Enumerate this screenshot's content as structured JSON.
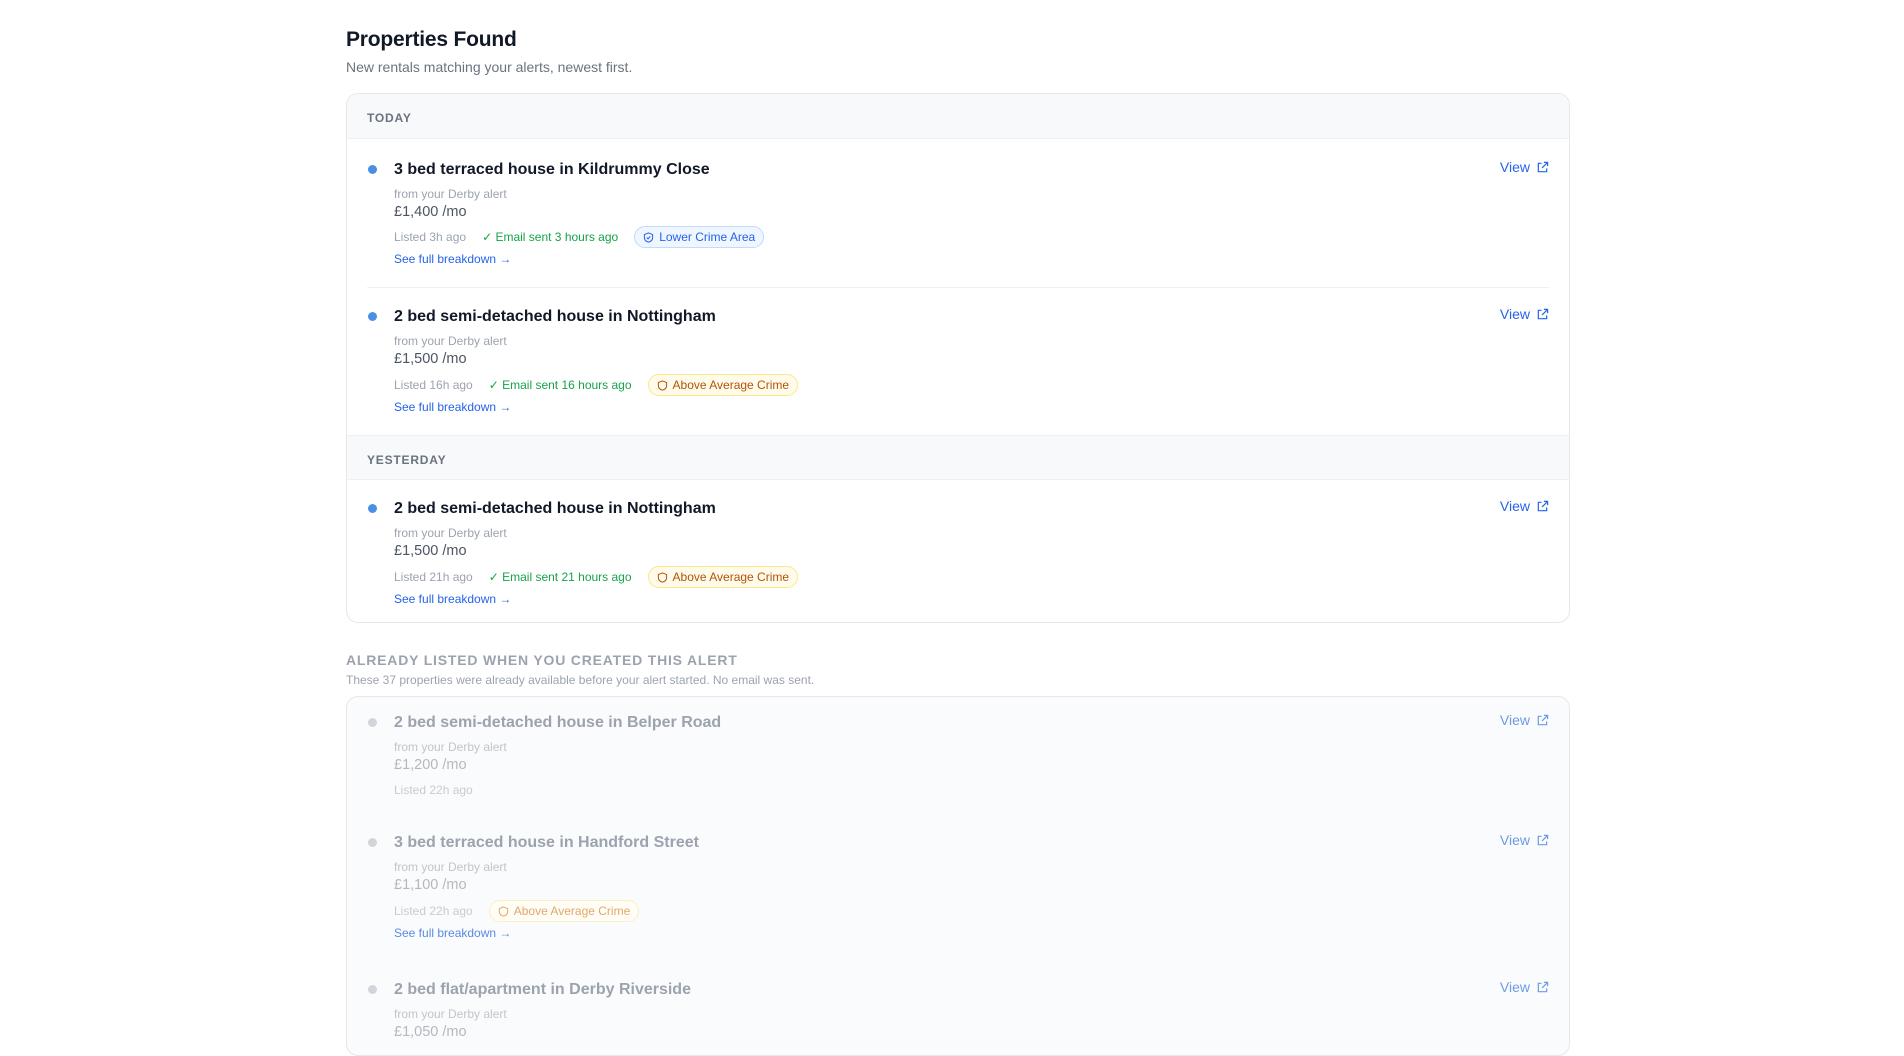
{
  "header": {
    "title": "Properties Found",
    "subtitle": "New rentals matching your alerts, newest first."
  },
  "groups": [
    {
      "label": "TODAY",
      "items": [
        {
          "title": "3 bed terraced house in Kildrummy Close",
          "source": "from your Derby alert",
          "price": "£1,400 /mo",
          "listed": "Listed 3h ago",
          "email": "✓ Email sent 3 hours ago",
          "crime": "Lower Crime Area",
          "crime_level": "low",
          "breakdown": "See full breakdown →",
          "view": "View"
        },
        {
          "title": "2 bed semi-detached house in Nottingham",
          "source": "from your Derby alert",
          "price": "£1,500 /mo",
          "listed": "Listed 16h ago",
          "email": "✓ Email sent 16 hours ago",
          "crime": "Above Average Crime",
          "crime_level": "high",
          "breakdown": "See full breakdown →",
          "view": "View"
        }
      ]
    },
    {
      "label": "YESTERDAY",
      "items": [
        {
          "title": "2 bed semi-detached house in Nottingham",
          "source": "from your Derby alert",
          "price": "£1,500 /mo",
          "listed": "Listed 21h ago",
          "email": "✓ Email sent 21 hours ago",
          "crime": "Above Average Crime",
          "crime_level": "high",
          "breakdown": "See full breakdown →",
          "view": "View"
        }
      ]
    }
  ],
  "already_listed": {
    "heading": "ALREADY LISTED WHEN YOU CREATED THIS ALERT",
    "subtitle": "These 37 properties were already available before your alert started. No email was sent.",
    "items": [
      {
        "title": "2 bed semi-detached house in Belper Road",
        "source": "from your Derby alert",
        "price": "£1,200 /mo",
        "listed": "Listed 22h ago",
        "view": "View"
      },
      {
        "title": "3 bed terraced house in Handford Street",
        "source": "from your Derby alert",
        "price": "£1,100 /mo",
        "listed": "Listed 22h ago",
        "crime": "Above Average Crime",
        "crime_level": "high",
        "breakdown": "See full breakdown →",
        "view": "View"
      },
      {
        "title": "2 bed flat/apartment in Derby Riverside",
        "source": "from your Derby alert",
        "price": "£1,050 /mo",
        "view": "View"
      }
    ]
  },
  "colors": {
    "accent": "#2563eb",
    "new_dot": "#4a90e2",
    "email_green": "#16a34a",
    "crime_low": "#2563eb",
    "crime_high": "#b45309"
  }
}
